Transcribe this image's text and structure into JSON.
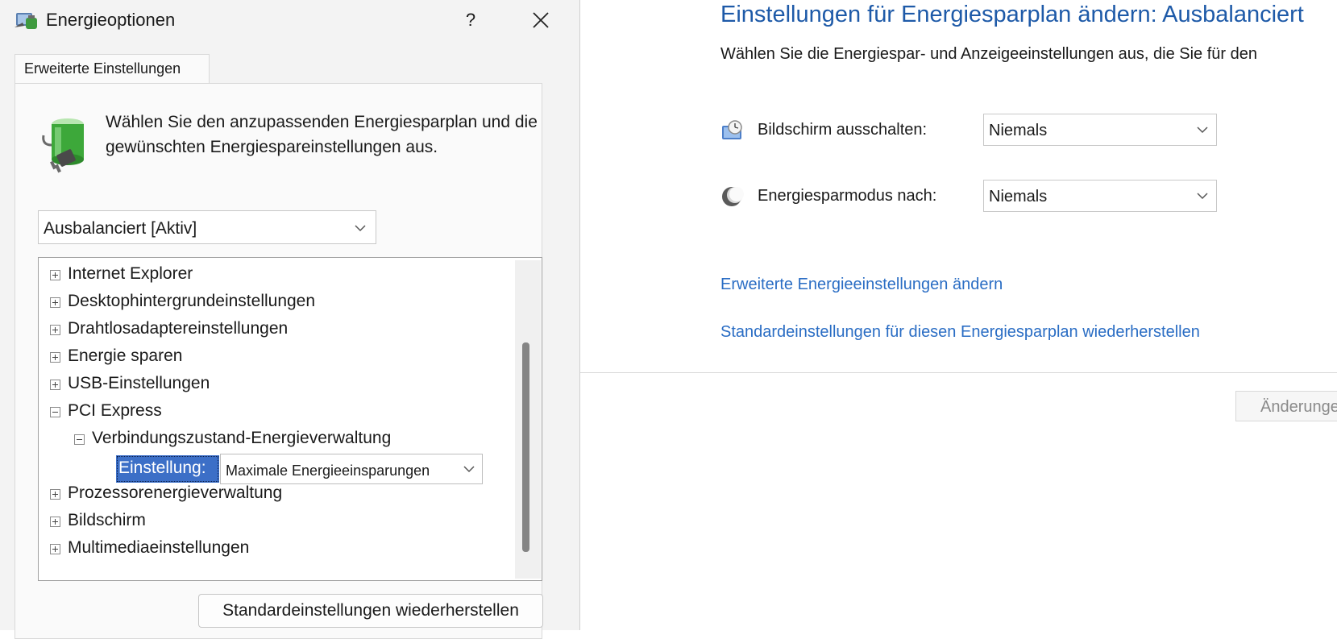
{
  "dialog": {
    "title": "Energieoptionen",
    "help_label": "?",
    "tab_label": "Erweiterte Einstellungen",
    "instruction": "Wählen Sie den anzupassenden Energiesparplan und die gewünschten Energiespareinstellungen aus.",
    "plan_select": {
      "value": "Ausbalanciert [Aktiv]"
    },
    "tree": {
      "items": [
        {
          "label": "Internet Explorer",
          "state": "collapsed"
        },
        {
          "label": "Desktophintergrundeinstellungen",
          "state": "collapsed"
        },
        {
          "label": "Drahtlosadaptereinstellungen",
          "state": "collapsed"
        },
        {
          "label": "Energie sparen",
          "state": "collapsed"
        },
        {
          "label": "USB-Einstellungen",
          "state": "collapsed"
        },
        {
          "label": "PCI Express",
          "state": "expanded"
        },
        {
          "label": "Verbindungszustand-Energieverwaltung",
          "state": "expanded"
        },
        {
          "label": "Prozessorenergieverwaltung",
          "state": "collapsed"
        },
        {
          "label": "Bildschirm",
          "state": "collapsed"
        },
        {
          "label": "Multimediaeinstellungen",
          "state": "collapsed"
        }
      ],
      "setting": {
        "label": "Einstellung:",
        "value": "Maximale Energieeinsparungen"
      }
    },
    "restore_button": "Standardeinstellungen wiederherstellen"
  },
  "control_panel": {
    "title": "Einstellungen für Energiesparplan ändern: Ausbalanciert",
    "description": "Wählen Sie die Energiespar- und Anzeigeeinstellungen aus, die Sie für den",
    "display_off": {
      "label": "Bildschirm ausschalten:",
      "value": "Niemals"
    },
    "sleep_after": {
      "label": "Energiesparmodus nach:",
      "value": "Niemals"
    },
    "link_advanced": "Erweiterte Energieeinstellungen ändern",
    "link_restore": "Standardeinstellungen für diesen Energiesparplan wiederherstellen",
    "apply_button": "Änderungen speichern"
  },
  "colors": {
    "accent_title": "#1e5aa8",
    "link": "#2a6dc4",
    "selection": "#3c6fc7",
    "dialog_bg": "#f3f3f3"
  },
  "icons": [
    "power-options-icon",
    "help-icon",
    "close-icon",
    "battery-plug-icon",
    "chevron-down-icon",
    "expand-icon",
    "collapse-icon",
    "monitor-clock-icon",
    "sleep-moon-icon"
  ]
}
